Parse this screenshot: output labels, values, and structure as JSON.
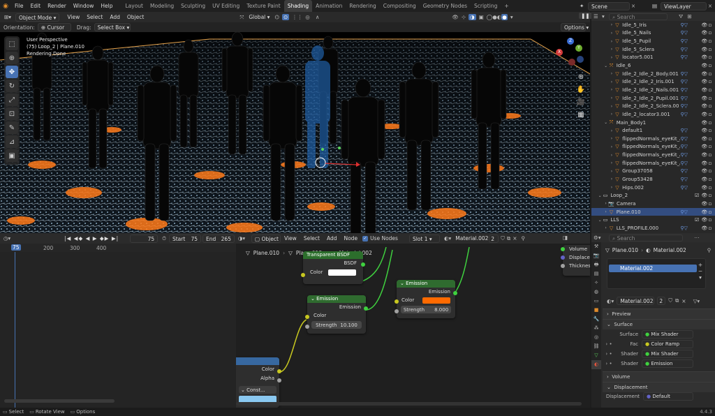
{
  "topbar": {
    "menus": [
      "File",
      "Edit",
      "Render",
      "Window",
      "Help"
    ],
    "workspaces": [
      "Layout",
      "Modeling",
      "Sculpting",
      "UV Editing",
      "Texture Paint",
      "Shading",
      "Animation",
      "Rendering",
      "Compositing",
      "Geometry Nodes",
      "Scripting"
    ],
    "active_workspace": "Shading",
    "scene": "Scene",
    "view_layer": "ViewLayer"
  },
  "viewport": {
    "mode": "Object Mode",
    "menus": [
      "View",
      "Select",
      "Add",
      "Object"
    ],
    "transform": "Global",
    "orientation_label": "Orientation:",
    "orientation_value": "Cursor",
    "drag_label": "Drag:",
    "drag_value": "Select Box",
    "options": "Options",
    "overlay_lines": [
      "User Perspective",
      "(75) Loop_2 | Plane.010",
      "Rendering Done"
    ],
    "gizmo": {
      "z": "Z",
      "y": "Y",
      "x": "X"
    }
  },
  "outliner": {
    "search_placeholder": "Search",
    "rows": [
      {
        "label": "Idle_5_Iris",
        "indent": 3,
        "icon": "mesh",
        "selected": false
      },
      {
        "label": "Idle_5_Nails",
        "indent": 3,
        "icon": "mesh",
        "selected": false
      },
      {
        "label": "Idle_5_Pupil",
        "indent": 3,
        "icon": "mesh",
        "selected": false
      },
      {
        "label": "Idle_5_Sclera",
        "indent": 3,
        "icon": "mesh",
        "selected": false
      },
      {
        "label": "locator5.001",
        "indent": 3,
        "icon": "mesh",
        "selected": false
      },
      {
        "label": "Idle_6",
        "indent": 2,
        "icon": "empty",
        "selected": false
      },
      {
        "label": "Idle_2_Idle_2_Body.001",
        "indent": 3,
        "icon": "mesh",
        "selected": false
      },
      {
        "label": "Idle_2_Idle_2_Iris.001",
        "indent": 3,
        "icon": "mesh",
        "selected": false
      },
      {
        "label": "Idle_2_Idle_2_Nails.001",
        "indent": 3,
        "icon": "mesh",
        "selected": false
      },
      {
        "label": "Idle_2_Idle_2_Pupil.001",
        "indent": 3,
        "icon": "mesh",
        "selected": false
      },
      {
        "label": "Idle_2_Idle_2_Sclera.00",
        "indent": 3,
        "icon": "mesh",
        "selected": false
      },
      {
        "label": "Idle_2_locator3.001",
        "indent": 3,
        "icon": "mesh",
        "selected": false
      },
      {
        "label": "Main_Body1",
        "indent": 2,
        "icon": "empty",
        "selected": false
      },
      {
        "label": "default1",
        "indent": 3,
        "icon": "mesh",
        "selected": false
      },
      {
        "label": "flippedNormals_eyeKit_A",
        "indent": 3,
        "icon": "mesh",
        "selected": false
      },
      {
        "label": "flippedNormals_eyeKit_A",
        "indent": 3,
        "icon": "mesh",
        "selected": false
      },
      {
        "label": "flippedNormals_eyeKit_A",
        "indent": 3,
        "icon": "mesh",
        "selected": false
      },
      {
        "label": "flippedNormals_eyeKit_A",
        "indent": 3,
        "icon": "mesh",
        "selected": false
      },
      {
        "label": "Group37058",
        "indent": 3,
        "icon": "mesh",
        "selected": false
      },
      {
        "label": "Group53428",
        "indent": 3,
        "icon": "mesh",
        "selected": false
      },
      {
        "label": "Hips.002",
        "indent": 3,
        "icon": "mesh",
        "selected": false
      },
      {
        "label": "Loop_2",
        "indent": 1,
        "icon": "collection",
        "selected": false
      },
      {
        "label": "Camera",
        "indent": 2,
        "icon": "camera",
        "selected": false
      },
      {
        "label": "Plane.010",
        "indent": 2,
        "icon": "mesh",
        "selected": true
      },
      {
        "label": "LLS",
        "indent": 1,
        "icon": "collection",
        "selected": false
      },
      {
        "label": "LLS_PROFILE.000",
        "indent": 2,
        "icon": "mesh",
        "selected": false
      }
    ]
  },
  "timeline": {
    "frame_current": "75",
    "start_label": "Start",
    "start": "75",
    "end_label": "End",
    "end": "265",
    "ruler": [
      "75",
      "200",
      "300",
      "400"
    ],
    "cursor_frame": 75
  },
  "node_editor": {
    "header": {
      "mode": "Object",
      "menus": [
        "View",
        "Select",
        "Add",
        "Node"
      ],
      "use_nodes": "Use Nodes",
      "slot": "Slot 1",
      "material": "Material.002",
      "users": "2"
    },
    "breadcrumb": [
      "Plane.010",
      "Plane.013",
      "Material.002"
    ],
    "nodes": {
      "transparent": {
        "title": "Transparent BSDF",
        "out": "BSDF",
        "in": "Color",
        "color_swatch": "#ffffff"
      },
      "emission1": {
        "title": "Emission",
        "out": "Emission",
        "in_color": "Color",
        "in_strength": "Strength",
        "strength": "10.100"
      },
      "emission2": {
        "title": "Emission",
        "out": "Emission",
        "in_color": "Color",
        "in_strength": "Strength",
        "strength": "8.000",
        "color_swatch": "#ff6a00"
      },
      "texture": {
        "out_color": "Color",
        "out_alpha": "Alpha",
        "mode": "Const..."
      },
      "output": {
        "in_volume": "Volume",
        "in_displacement": "Displacem",
        "in_thickness": "Thicknes"
      }
    }
  },
  "properties": {
    "search_placeholder": "Search",
    "breadcrumb": [
      "Plane.010",
      "Material.002"
    ],
    "slot": "Material.002",
    "material": "Material.002",
    "users": "2",
    "panels": {
      "preview": "Preview",
      "surface": "Surface",
      "volume": "Volume",
      "displacement": "Displacement"
    },
    "surface_rows": [
      {
        "label": "Surface",
        "value": "Mix Shader"
      },
      {
        "label": "Fac",
        "value": "Color Ramp"
      },
      {
        "label": "Shader",
        "value": "Mix Shader"
      },
      {
        "label": "Shader",
        "value": "Emission"
      }
    ],
    "displacement_row": {
      "label": "Displacement",
      "value": "Default"
    }
  },
  "statusbar": {
    "items": [
      "Select",
      "Rotate View",
      "Options"
    ],
    "version": "4.4.3"
  },
  "colors": {
    "accent": "#4772b3",
    "selected_row": "#334d80",
    "node_input_green": "#2c6e2c",
    "node_emission": "#2f6b2f",
    "link_yellow": "#c8c820",
    "link_green": "#3fd13f"
  }
}
